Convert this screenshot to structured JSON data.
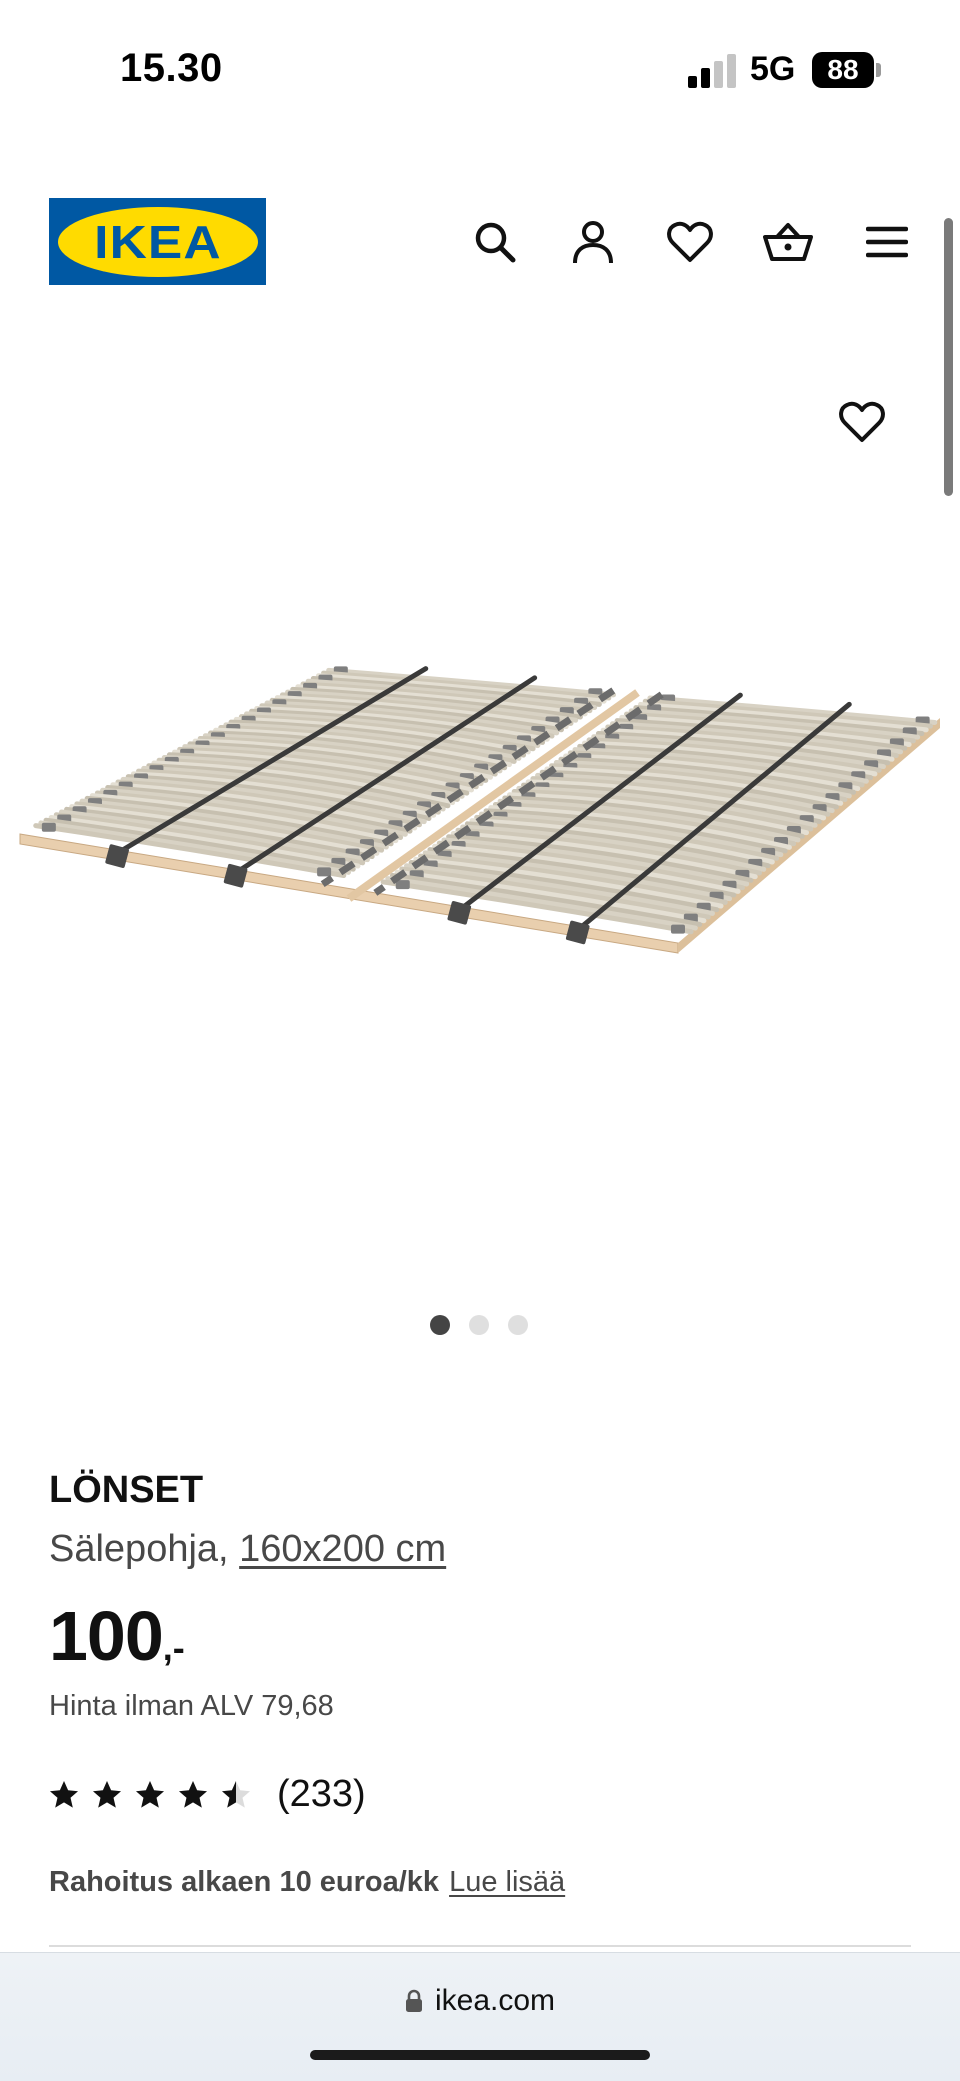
{
  "status_bar": {
    "time": "15.30",
    "network": "5G",
    "battery": "88"
  },
  "header": {
    "logo_text": "IKEA",
    "icons": [
      "search-icon",
      "account-icon",
      "heart-icon",
      "basket-icon",
      "menu-icon"
    ]
  },
  "gallery": {
    "image_count": 3,
    "active_index": 0
  },
  "product": {
    "name": "LÖNSET",
    "type": "Sälepohja,",
    "size": "160x200 cm",
    "price": "100",
    "price_suffix": ",-",
    "vat_text": "Hinta ilman ALV 79,68",
    "rating": 4.5,
    "rating_max": 5,
    "reviews": "(233)"
  },
  "financing": {
    "text": "Rahoitus alkaen 10 euroa/kk",
    "link": "Lue lisää"
  },
  "browser": {
    "url": "ikea.com"
  },
  "colors": {
    "ikea_blue": "#0058a3",
    "ikea_yellow": "#ffdb00",
    "text_primary": "#111111",
    "text_secondary": "#484848"
  }
}
